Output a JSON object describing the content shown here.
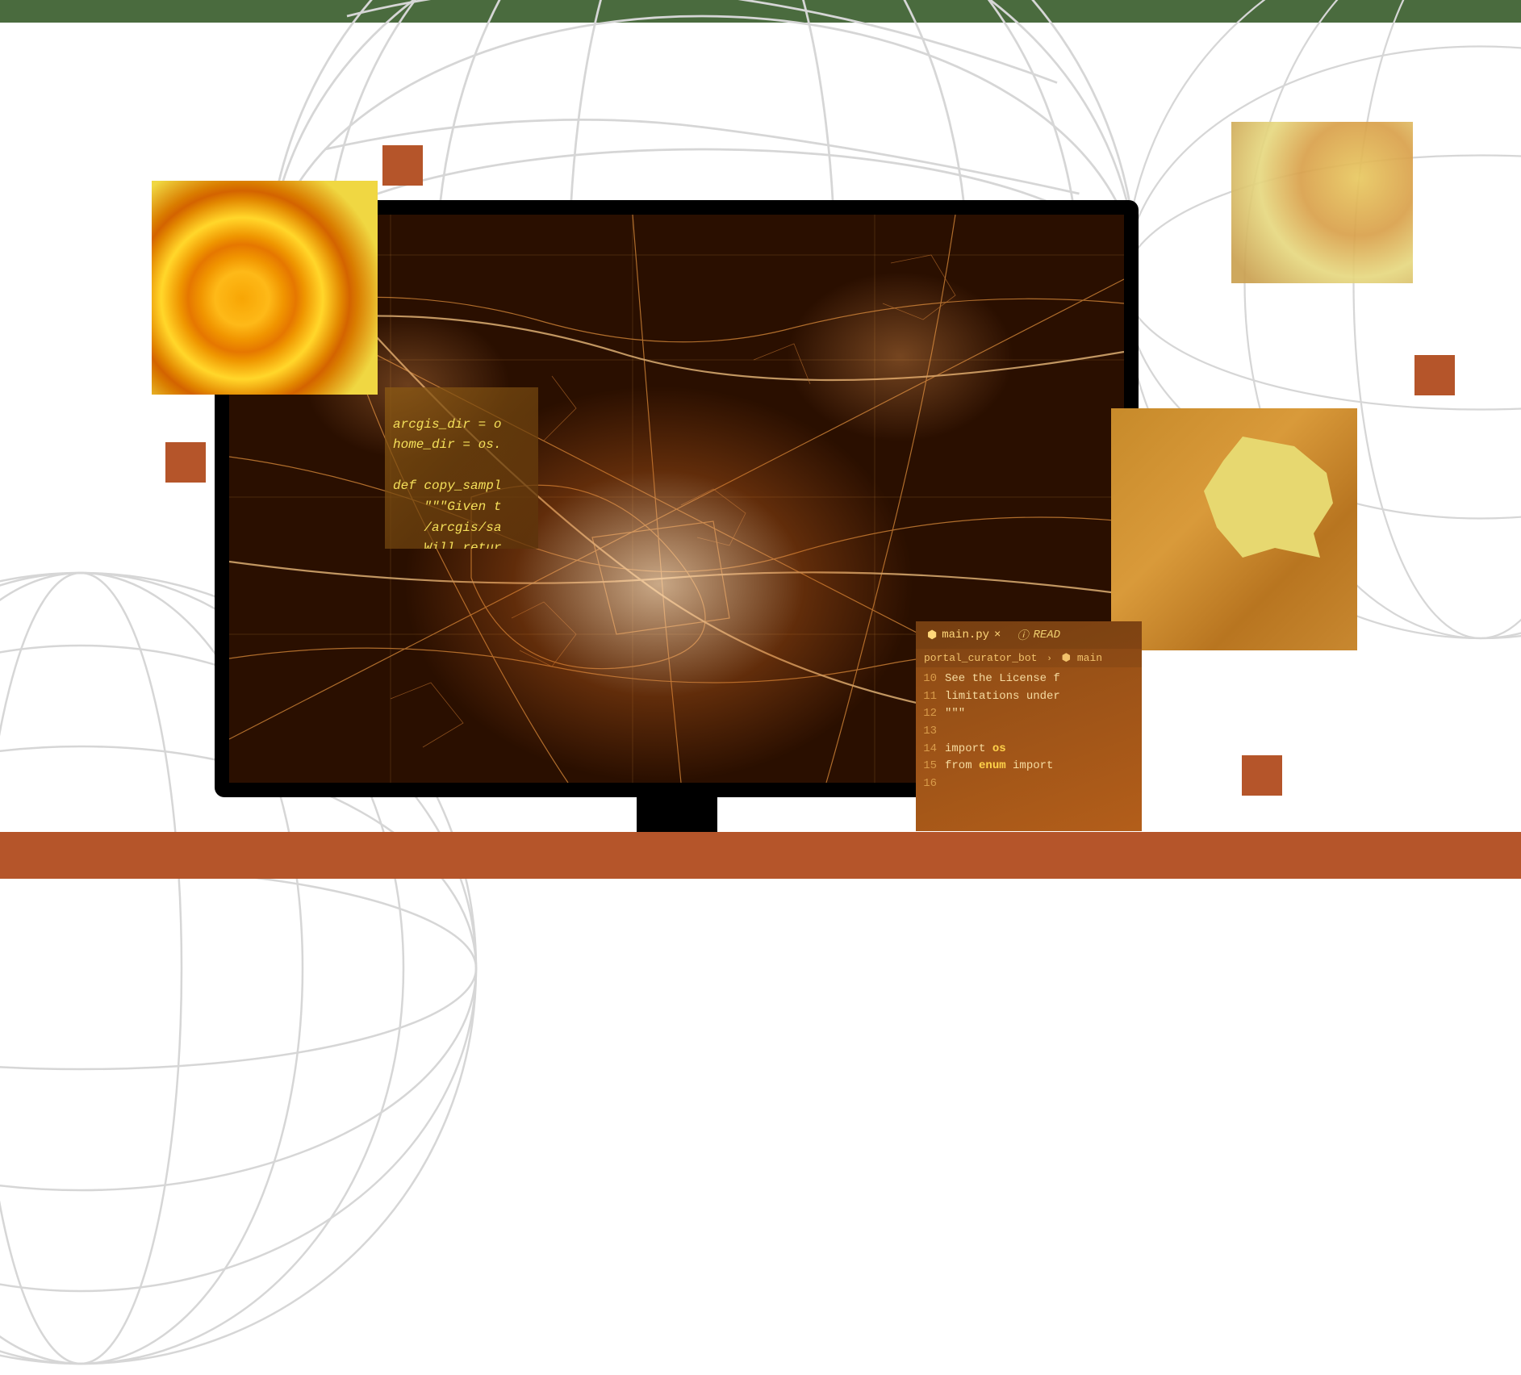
{
  "colors": {
    "top_bar": "#4a6b3e",
    "accent": "#b5552a",
    "code_text": "#f5e05a",
    "editor_bg_start": "#8a4a15",
    "editor_bg_end": "#b35e1a"
  },
  "decor_squares": [
    "sq-1",
    "sq-2",
    "sq-3",
    "sq-4"
  ],
  "decor_images": {
    "swirl": "swirl-heatmap",
    "cloud": "cloud-heatmap",
    "region": "region-heatmap"
  },
  "code_snippet_1": {
    "lines": [
      "arcgis_dir = o",
      "home_dir = os.",
      "",
      "def copy_sampl",
      "    \"\"\"Given t",
      "    /arcgis/sa",
      "    Will retur"
    ]
  },
  "editor": {
    "tabs": [
      {
        "icon": "python-file-icon",
        "label": "main.py",
        "active": true,
        "closeable": true
      },
      {
        "icon": "info-icon",
        "label": "READ",
        "active": false,
        "closeable": false
      }
    ],
    "breadcrumb": {
      "segments": [
        "portal_curator_bot",
        "main"
      ]
    },
    "lines": [
      {
        "num": "10",
        "code": "See the License f"
      },
      {
        "num": "11",
        "code": "limitations under"
      },
      {
        "num": "12",
        "code": "\"\"\""
      },
      {
        "num": "13",
        "code": ""
      },
      {
        "num": "14",
        "code_pre": "import ",
        "kw": "os",
        "code_post": ""
      },
      {
        "num": "15",
        "code_pre": "from ",
        "kw": "enum",
        "code_post": " import"
      },
      {
        "num": "16",
        "code": ""
      }
    ]
  }
}
